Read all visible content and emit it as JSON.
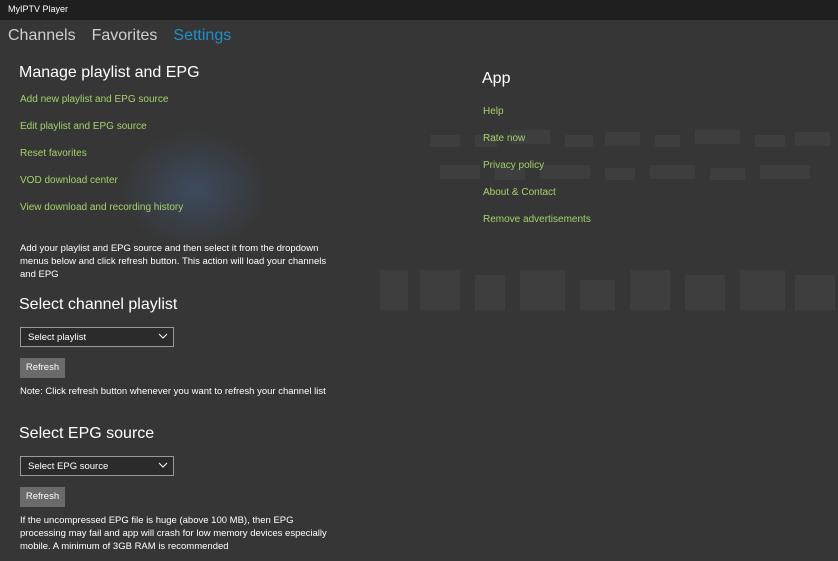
{
  "window": {
    "title": "MyIPTV Player"
  },
  "nav": {
    "tabs": [
      "Channels",
      "Favorites",
      "Settings"
    ],
    "active": "Settings"
  },
  "manage": {
    "title": "Manage playlist and EPG",
    "links": [
      "Add new playlist and EPG source",
      "Edit playlist and EPG source",
      "Reset favorites",
      "VOD download center",
      "View download and recording history"
    ],
    "info": "Add your playlist and EPG source and then select it from the dropdown menus below and click refresh button. This action will load your channels and EPG"
  },
  "playlist": {
    "title": "Select channel playlist",
    "select_value": "Select playlist",
    "refresh_label": "Refresh",
    "note": "Note: Click refresh button whenever you want to refresh your channel list"
  },
  "epg": {
    "title": "Select EPG source",
    "select_value": "Select EPG source",
    "refresh_label": "Refresh",
    "note": "If the uncompressed EPG file is huge (above 100 MB), then EPG processing may fail and app will crash for low memory devices especially mobile. A minimum of 3GB RAM is recommended"
  },
  "app": {
    "title": "App",
    "links": [
      "Help",
      "Rate now",
      "Privacy policy",
      "About & Contact",
      "Remove advertisements"
    ]
  },
  "colors": {
    "accent": "#1e90c9",
    "link": "#a3d36b",
    "background": "#363636",
    "titlebar": "#1f1f1f"
  }
}
